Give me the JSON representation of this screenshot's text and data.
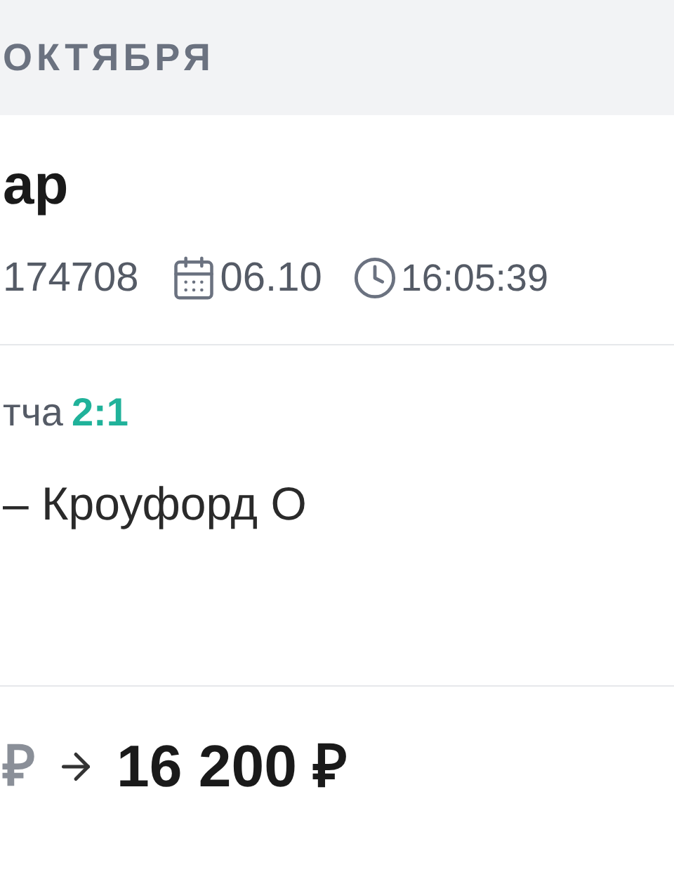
{
  "date_header": "ОКТЯБРЯ",
  "bet": {
    "title": "ар",
    "id": "174708",
    "date": "06.10",
    "time": "16:05:39"
  },
  "score": {
    "label": "тча",
    "value": "2:1"
  },
  "match": "– Кроуфорд О",
  "payout": {
    "stake": "₽",
    "win": "16 200 ₽"
  }
}
